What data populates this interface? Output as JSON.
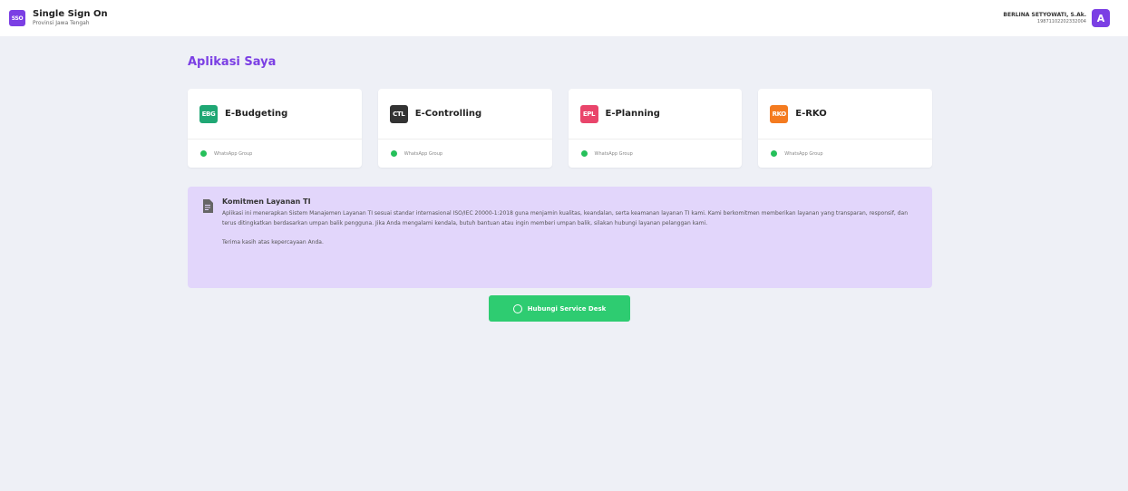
{
  "header": {
    "logo_text": "SSO",
    "title": "Single Sign On",
    "subtitle": "Provinsi Jawa Tengah",
    "user_name": "BERLINA SETYOWATI, S.Ak.",
    "user_id": "19871102202332004",
    "avatar_letter": "A"
  },
  "page": {
    "title": "Aplikasi Saya"
  },
  "apps": [
    {
      "logo": "EBG",
      "name": "E-Budgeting",
      "link": "WhatsApp Group",
      "color": "#1fa774"
    },
    {
      "logo": "CTL",
      "name": "E-Controlling",
      "link": "WhatsApp Group",
      "color": "#333333"
    },
    {
      "logo": "EPL",
      "name": "E-Planning",
      "link": "WhatsApp Group",
      "color": "#e9456b"
    },
    {
      "logo": "RKO",
      "name": "E-RKO",
      "link": "WhatsApp Group",
      "color": "#f47b20"
    }
  ],
  "notice": {
    "icon": "document-icon",
    "title": "Komitmen Layanan TI",
    "paragraph": "Aplikasi ini menerapkan Sistem Manajemen Layanan TI sesuai standar internasional ISO/IEC 20000-1:2018 guna menjamin kualitas, keandalan, serta keamanan layanan TI kami. Kami berkomitmen memberikan layanan yang transparan, responsif, dan terus ditingkatkan berdasarkan umpan balik pengguna. Jika Anda mengalami kendala, butuh bantuan atau ingin memberi umpan balik, silakan hubungi layanan pelanggan kami.",
    "thanks": "Terima kasih atas kepercayaan Anda."
  },
  "cta": {
    "label": "Hubungi Service Desk",
    "icon": "whatsapp-icon"
  },
  "colors": {
    "accent": "#7b3fe4",
    "cta": "#2ecc71",
    "notice_bg": "#e2d6fb"
  }
}
